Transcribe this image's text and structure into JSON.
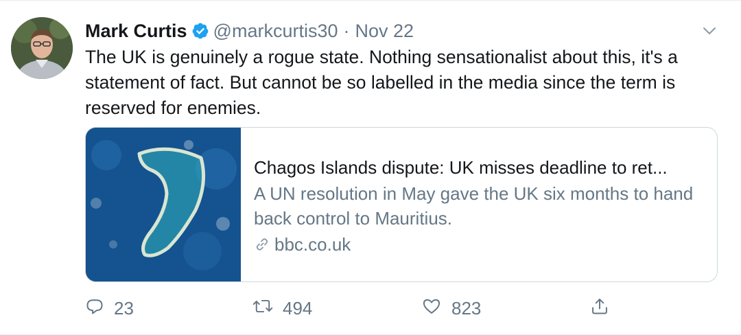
{
  "author": {
    "name": "Mark Curtis",
    "handle": "@markcurtis30",
    "separator": "·",
    "date": "Nov 22",
    "verified": true
  },
  "tweet": {
    "text": "The UK is genuinely a rogue state. Nothing sensationalist about this, it's a statement of fact. But cannot be so labelled in the media since the term is reserved for enemies."
  },
  "card": {
    "title": "Chagos Islands dispute: UK misses deadline to ret...",
    "description": "A UN resolution in May gave the UK six months to hand back control to Mauritius.",
    "domain": "bbc.co.uk"
  },
  "actions": {
    "reply_count": "23",
    "retweet_count": "494",
    "like_count": "823"
  },
  "colors": {
    "text": "#14171a",
    "secondary": "#657786",
    "verified": "#1da1f2",
    "border": "#ccd6dd"
  },
  "icons": [
    "verified-badge-icon",
    "chevron-down-icon",
    "link-icon",
    "reply-icon",
    "retweet-icon",
    "like-icon",
    "share-icon"
  ]
}
